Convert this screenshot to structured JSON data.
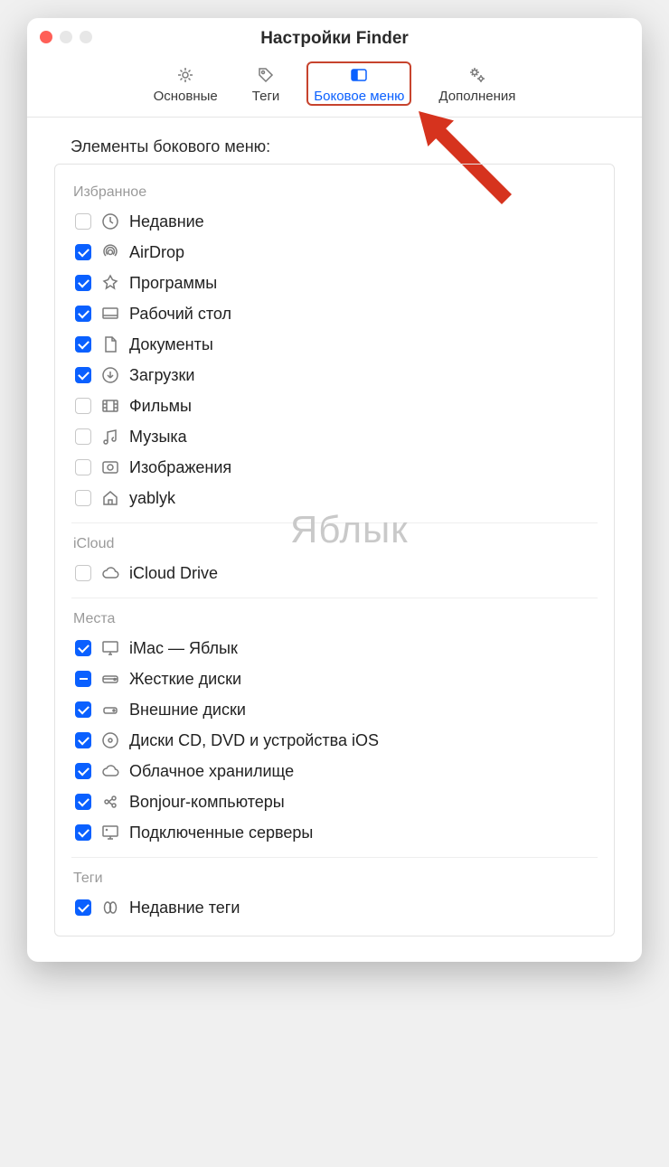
{
  "window": {
    "title": "Настройки Finder"
  },
  "tabs": {
    "general": "Основные",
    "tags": "Теги",
    "sidebar": "Боковое меню",
    "advanced": "Дополнения",
    "active": "sidebar"
  },
  "heading": "Элементы бокового меню:",
  "watermark": "Яблык",
  "sections": [
    {
      "label": "Избранное",
      "items": [
        {
          "icon": "clock",
          "label": "Недавние",
          "checked": false
        },
        {
          "icon": "airdrop",
          "label": "AirDrop",
          "checked": true
        },
        {
          "icon": "apps",
          "label": "Программы",
          "checked": true
        },
        {
          "icon": "desktop",
          "label": "Рабочий стол",
          "checked": true
        },
        {
          "icon": "document",
          "label": "Документы",
          "checked": true
        },
        {
          "icon": "download",
          "label": "Загрузки",
          "checked": true
        },
        {
          "icon": "movies",
          "label": "Фильмы",
          "checked": false
        },
        {
          "icon": "music",
          "label": "Музыка",
          "checked": false
        },
        {
          "icon": "pictures",
          "label": "Изображения",
          "checked": false
        },
        {
          "icon": "home",
          "label": "yablyk",
          "checked": false
        }
      ]
    },
    {
      "label": "iCloud",
      "items": [
        {
          "icon": "cloud",
          "label": "iCloud Drive",
          "checked": false
        }
      ]
    },
    {
      "label": "Места",
      "items": [
        {
          "icon": "imac",
          "label": "iMac — Яблык",
          "checked": true
        },
        {
          "icon": "hdd",
          "label": "Жесткие диски",
          "checked": "mixed"
        },
        {
          "icon": "external",
          "label": "Внешние диски",
          "checked": true
        },
        {
          "icon": "disc",
          "label": "Диски CD, DVD и устройства iOS",
          "checked": true
        },
        {
          "icon": "cloud",
          "label": "Облачное хранилище",
          "checked": true
        },
        {
          "icon": "bonjour",
          "label": "Bonjour-компьютеры",
          "checked": true
        },
        {
          "icon": "server",
          "label": "Подключенные серверы",
          "checked": true
        }
      ]
    },
    {
      "label": "Теги",
      "items": [
        {
          "icon": "tags",
          "label": "Недавние теги",
          "checked": true
        }
      ]
    }
  ]
}
